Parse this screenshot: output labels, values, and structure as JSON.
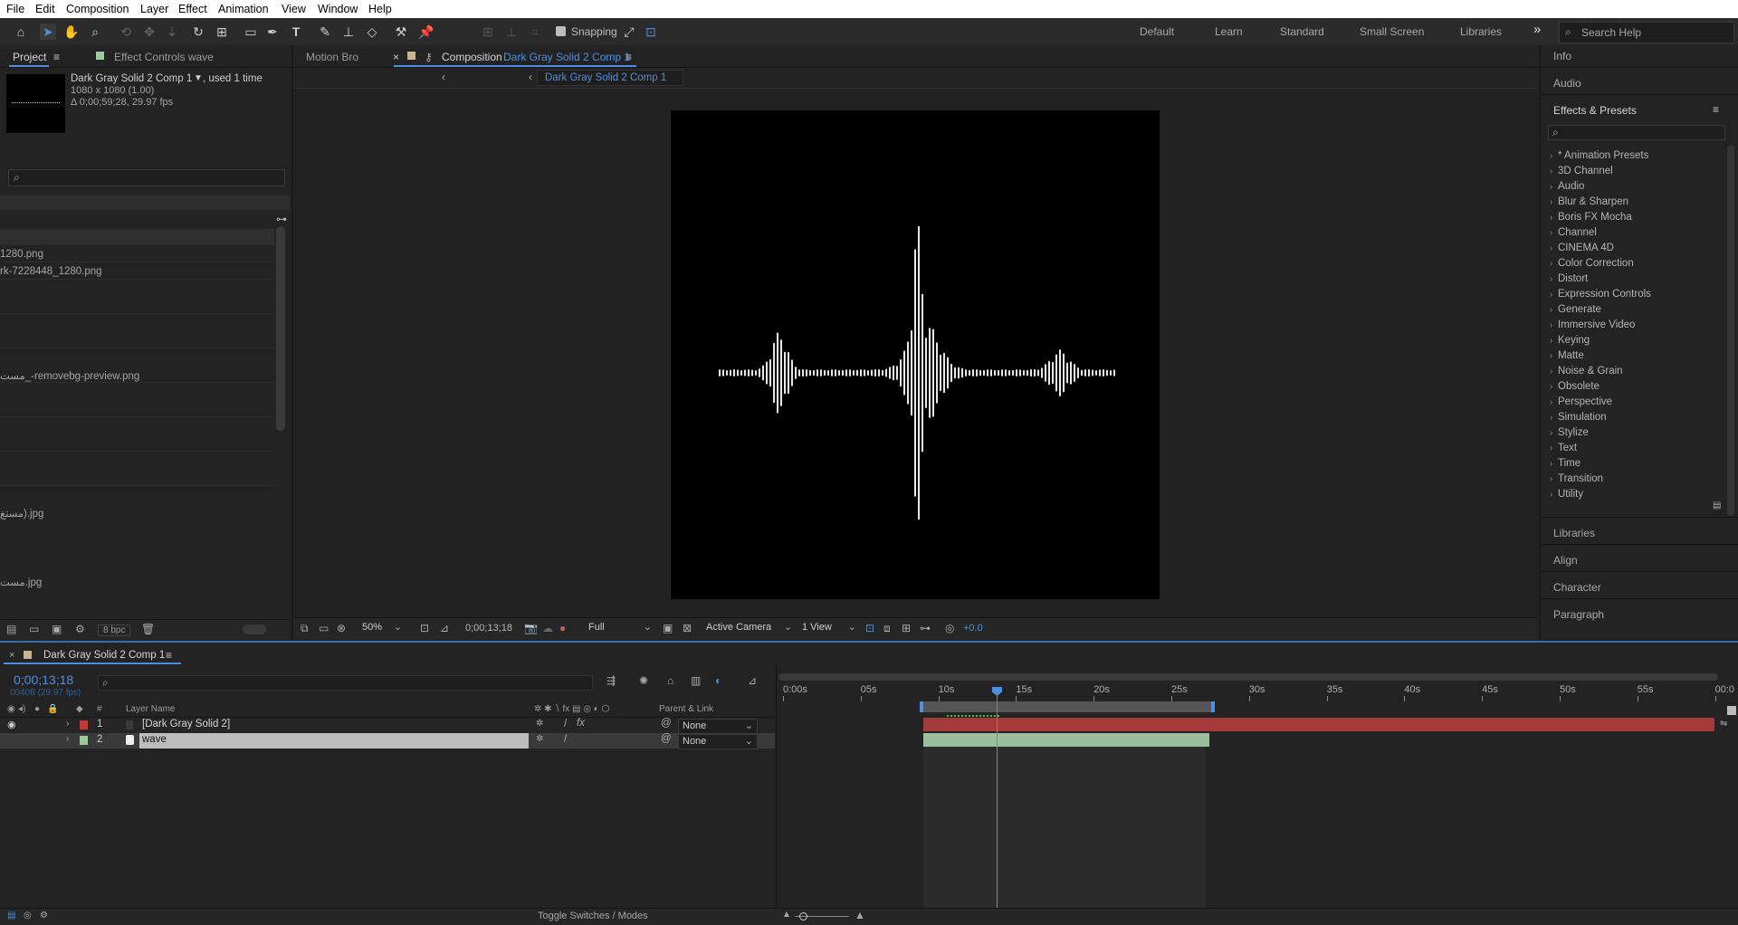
{
  "menu": [
    "File",
    "Edit",
    "Composition",
    "Layer",
    "Effect",
    "Animation",
    "View",
    "Window",
    "Help"
  ],
  "toolbar": {
    "snapping_label": "Snapping",
    "workspaces": [
      "Default",
      "Learn",
      "Standard",
      "Small Screen",
      "Libraries"
    ],
    "more_glyph": "»",
    "search_placeholder": "Search Help"
  },
  "project": {
    "tabs": [
      "Project",
      "Effect Controls wave"
    ],
    "menu_glyph": "≡",
    "selected_name": "Dark Gray Solid 2 Comp 1",
    "used_text": ", used 1 time",
    "dimensions": "1080 x 1080 (1.00)",
    "duration": "Δ 0;00;59;28, 29.97 fps",
    "files": [
      "1280.png",
      "rk-7228448_1280.png",
      "مست_-removebg-preview.png",
      "مستغ).jpg",
      "مست.jpg"
    ],
    "bpc": "8 bpc"
  },
  "viewer": {
    "tab_motion": "Motion Bro",
    "tab_comp_prefix": "Composition",
    "tab_comp_name": "Dark Gray Solid 2 Comp 1",
    "breadcrumb": "Dark Gray Solid 2 Comp 1",
    "zoom": "50%",
    "timecode": "0;00;13;18",
    "resolution": "Full",
    "camera": "Active Camera",
    "views": "1 View",
    "exposure": "+0.0"
  },
  "right": {
    "info": "Info",
    "audio": "Audio",
    "effects_title": "Effects & Presets",
    "effects": [
      "* Animation Presets",
      "3D Channel",
      "Audio",
      "Blur & Sharpen",
      "Boris FX Mocha",
      "Channel",
      "CINEMA 4D",
      "Color Correction",
      "Distort",
      "Expression Controls",
      "Generate",
      "Immersive Video",
      "Keying",
      "Matte",
      "Noise & Grain",
      "Obsolete",
      "Perspective",
      "Simulation",
      "Stylize",
      "Text",
      "Time",
      "Transition",
      "Utility"
    ],
    "panels": [
      "Libraries",
      "Align",
      "Character",
      "Paragraph"
    ]
  },
  "timeline": {
    "comp_tab": "Dark Gray Solid 2 Comp 1",
    "timecode": "0;00;13;18",
    "frame_info": "00408 (29.97 fps)",
    "col_num": "#",
    "col_layer": "Layer Name",
    "col_parent": "Parent & Link",
    "layers": [
      {
        "num": "1",
        "name": "[Dark Gray Solid 2]",
        "color": "#c23a3a",
        "parent": "None"
      },
      {
        "num": "2",
        "name": "wave",
        "color": "#9ec8a0",
        "parent": "None"
      }
    ],
    "ruler": [
      "0:00s",
      "05s",
      "10s",
      "15s",
      "20s",
      "25s",
      "30s",
      "35s",
      "40s",
      "45s",
      "50s",
      "55s",
      "00:0"
    ],
    "toggle_label": "Toggle Switches / Modes"
  },
  "colors": {
    "accent": "#4d8fe0",
    "layer1": "#c23a3a",
    "layer2": "#9ec8a0"
  }
}
